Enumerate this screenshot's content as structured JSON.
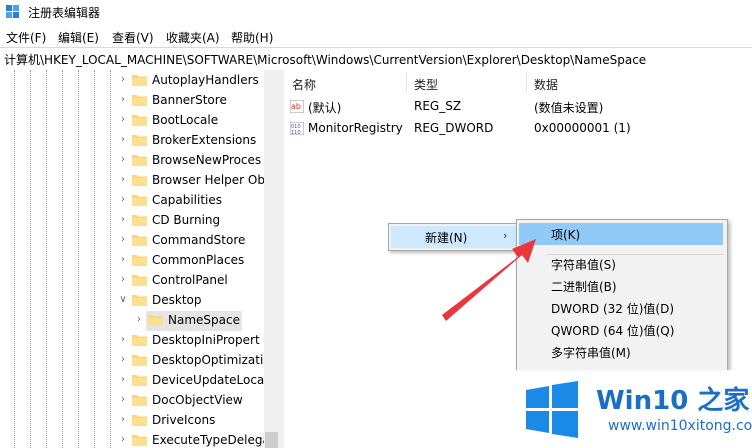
{
  "window": {
    "title": "注册表编辑器"
  },
  "menu": [
    "文件(F)",
    "编辑(E)",
    "查看(V)",
    "收藏夹(A)",
    "帮助(H)"
  ],
  "address": "计算机\\HKEY_LOCAL_MACHINE\\SOFTWARE\\Microsoft\\Windows\\CurrentVersion\\Explorer\\Desktop\\NameSpace",
  "tree": {
    "items": [
      {
        "label": "AutoplayHandlers",
        "expanded": false
      },
      {
        "label": "BannerStore",
        "expanded": false
      },
      {
        "label": "BootLocale",
        "expanded": false
      },
      {
        "label": "BrokerExtensions",
        "expanded": false
      },
      {
        "label": "BrowseNewProces",
        "expanded": false
      },
      {
        "label": "Browser Helper Ob",
        "expanded": false
      },
      {
        "label": "Capabilities",
        "expanded": false
      },
      {
        "label": "CD Burning",
        "expanded": false
      },
      {
        "label": "CommandStore",
        "expanded": false
      },
      {
        "label": "CommonPlaces",
        "expanded": false
      },
      {
        "label": "ControlPanel",
        "expanded": false
      },
      {
        "label": "Desktop",
        "expanded": true
      },
      {
        "label": "NameSpace",
        "expanded": false,
        "selected": true,
        "child": true
      },
      {
        "label": "DesktopIniPropert",
        "expanded": false
      },
      {
        "label": "DesktopOptimizati",
        "expanded": false
      },
      {
        "label": "DeviceUpdateLoca",
        "expanded": false
      },
      {
        "label": "DocObjectView",
        "expanded": false
      },
      {
        "label": "DriveIcons",
        "expanded": false
      },
      {
        "label": "ExecuteTypeDelega",
        "expanded": false
      }
    ]
  },
  "values": {
    "headers": [
      "名称",
      "类型",
      "数据"
    ],
    "rows": [
      {
        "name": "(默认)",
        "type": "REG_SZ",
        "data": "(数值未设置)",
        "icon": "string-value-icon"
      },
      {
        "name": "MonitorRegistry",
        "type": "REG_DWORD",
        "data": "0x00000001 (1)",
        "icon": "binary-value-icon"
      }
    ]
  },
  "context_menu": {
    "new_label": "新建(N)"
  },
  "submenu": {
    "items": [
      "项(K)",
      "字符串值(S)",
      "二进制值(B)",
      "DWORD (32 位)值(D)",
      "QWORD (64 位)值(Q)",
      "多字符串值(M)"
    ],
    "highlighted": "项(K)"
  },
  "watermark": {
    "title": "Win10 之家",
    "url": "www.win10xitong.com"
  },
  "colors": {
    "folder": "#f8d775",
    "menu_highlight": "#91c9f7",
    "arrow": "#e8383d",
    "brand": "#1a6fc4"
  }
}
